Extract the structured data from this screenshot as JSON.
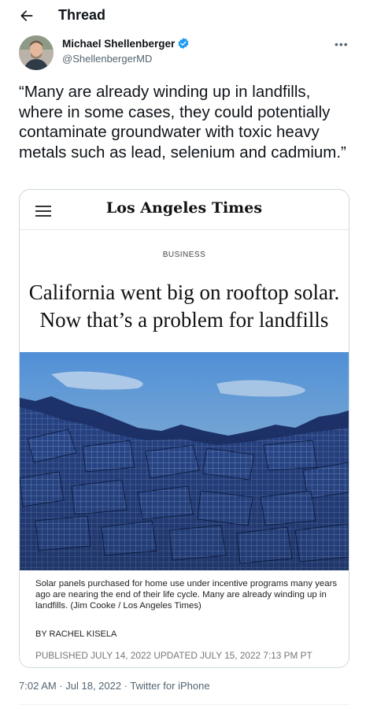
{
  "header": {
    "title": "Thread"
  },
  "author": {
    "name": "Michael Shellenberger",
    "handle": "@ShellenbergerMD"
  },
  "tweet": {
    "text": "“Many are already winding up in landfills, where in some cases, they could potentially contaminate groundwater with toxic heavy metals such as lead, selenium and cadmium.”",
    "timestamp": "7:02 AM · Jul 18, 2022 · Twitter for iPhone"
  },
  "card": {
    "logo": "Los Angeles Times",
    "section": "BUSINESS",
    "headline_line1": "California went big on rooftop solar.",
    "headline_line2": "Now that’s a problem for landfills",
    "caption": "Solar panels purchased for home use under incentive programs many years ago are nearing the end of their life cycle. Many are already winding up in landfills. (Jim Cooke / Los Angeles Times)",
    "byline": "BY RACHEL KISELA",
    "published": "PUBLISHED JULY 14, 2022 UPDATED JULY 15, 2022 7:13 PM PT"
  },
  "icons": {
    "back": "back-arrow-icon",
    "verified": "verified-badge-icon",
    "more": "more-options-icon",
    "menu": "hamburger-menu-icon"
  },
  "colors": {
    "verified": "#1d9bf0",
    "secondary_text": "#536471"
  }
}
